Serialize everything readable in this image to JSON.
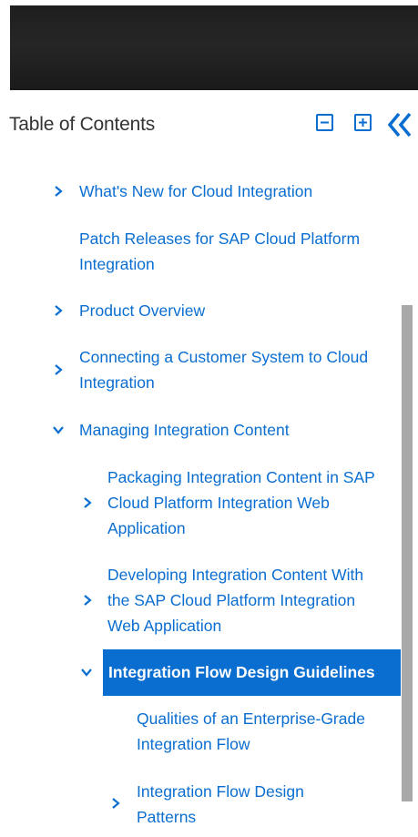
{
  "toc": {
    "title": "Table of Contents",
    "collapse_all_label": "−",
    "expand_all_label": "+",
    "hide_label": "«"
  },
  "items": [
    {
      "label": "What's New for Cloud Integration",
      "chevron": "right"
    },
    {
      "label": "Patch Releases for SAP Cloud Platform Integration",
      "chevron": "none"
    },
    {
      "label": "Product Overview",
      "chevron": "right"
    },
    {
      "label": "Connecting a Customer System to Cloud Integration",
      "chevron": "right"
    },
    {
      "label": "Managing Integration Content",
      "chevron": "down"
    },
    {
      "label": "Packaging Integration Content in SAP Cloud Platform Integration Web Application",
      "chevron": "right"
    },
    {
      "label": "Developing Integration Content With the SAP Cloud Platform Integration Web Application",
      "chevron": "right"
    },
    {
      "label": "Integration Flow Design Guidelines",
      "chevron": "down",
      "selected": true
    },
    {
      "label": "Qualities of an Enterprise-Grade Integration Flow",
      "chevron": "none"
    },
    {
      "label": "Integration Flow Design Patterns",
      "chevron": "right"
    }
  ],
  "colors": {
    "link": "#0a6ed1",
    "selected_bg": "#0a6ed1",
    "selected_text": "#ffffff",
    "scrollbar": "#a9a9a9"
  }
}
